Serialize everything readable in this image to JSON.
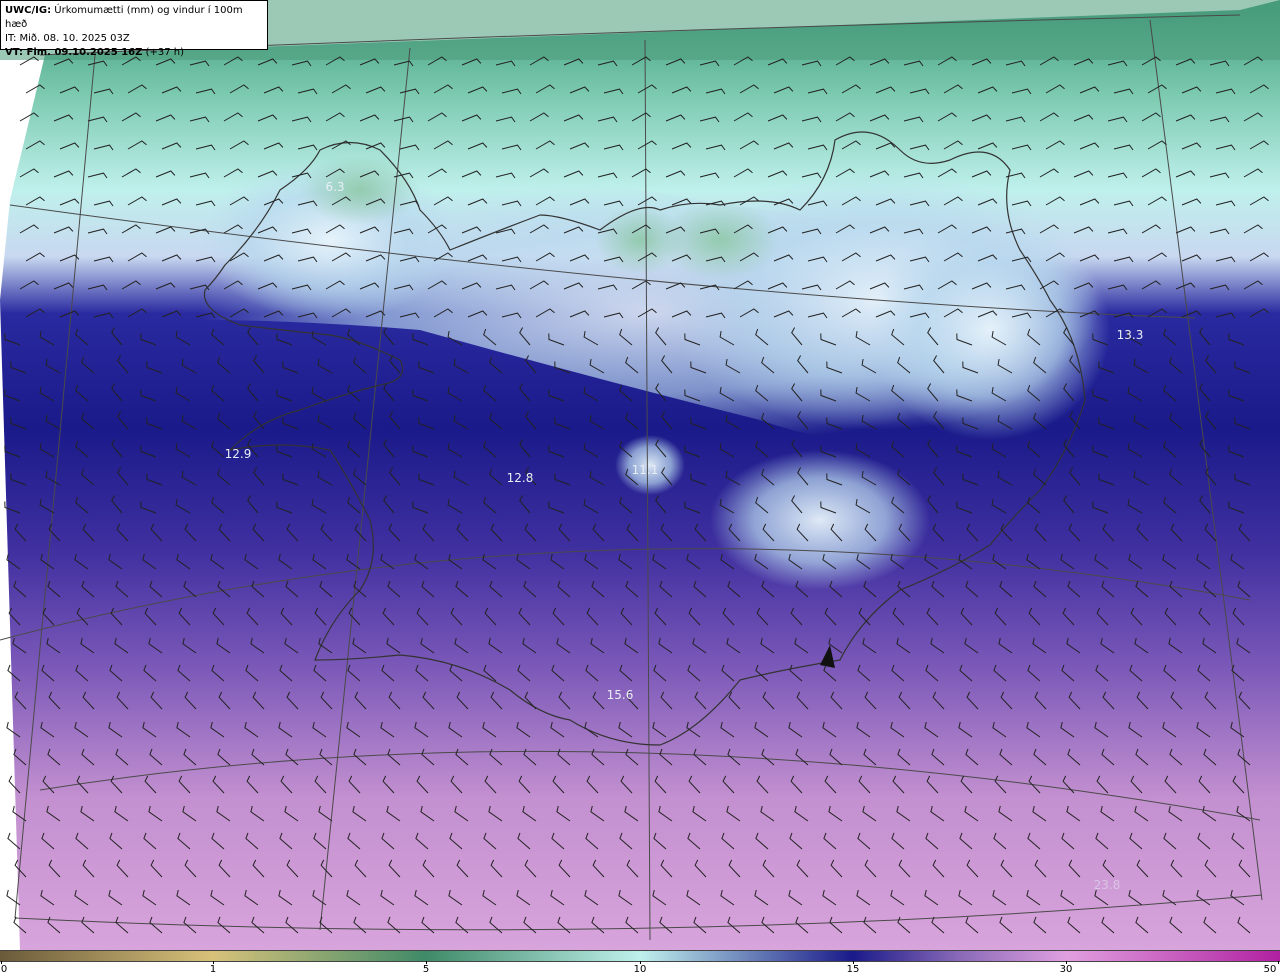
{
  "title": {
    "product": "UWC/IG:",
    "description": "Úrkomumætti (mm) og vindur í 100m hæð",
    "issue_time": "IT: Mið. 08. 10. 2025 03Z",
    "valid_label": "VT: Fim. 09.10.2025 16Z",
    "valid_offset": "(+37 h)"
  },
  "map_labels": [
    {
      "id": "pw-6-3",
      "text": "6.3",
      "faint": false
    },
    {
      "id": "pw-13-3",
      "text": "13.3",
      "faint": false
    },
    {
      "id": "pw-12-9",
      "text": "12.9",
      "faint": false
    },
    {
      "id": "pw-12-8",
      "text": "12.8",
      "faint": false
    },
    {
      "id": "pw-11-1",
      "text": "11.1",
      "faint": false
    },
    {
      "id": "pw-15-6",
      "text": "15.6",
      "faint": false
    },
    {
      "id": "pw-23-8",
      "text": "23.8",
      "faint": true
    }
  ],
  "colorbar": {
    "ticks": [
      "0",
      "1",
      "5",
      "10",
      "15",
      "30",
      "50"
    ],
    "colors": {
      "brown": "#6b5a3a",
      "tan": "#d8c27a",
      "green": "#3f8a68",
      "mint": "#bff0ec",
      "navy": "#1a1a8a",
      "purple": "#8a6ab8",
      "pink": "#e0a0e0",
      "magenta": "#b020a0"
    }
  },
  "colors": {
    "land_outline": "#333333",
    "grid_line": "#4a4a4a",
    "barb": "#222222"
  }
}
